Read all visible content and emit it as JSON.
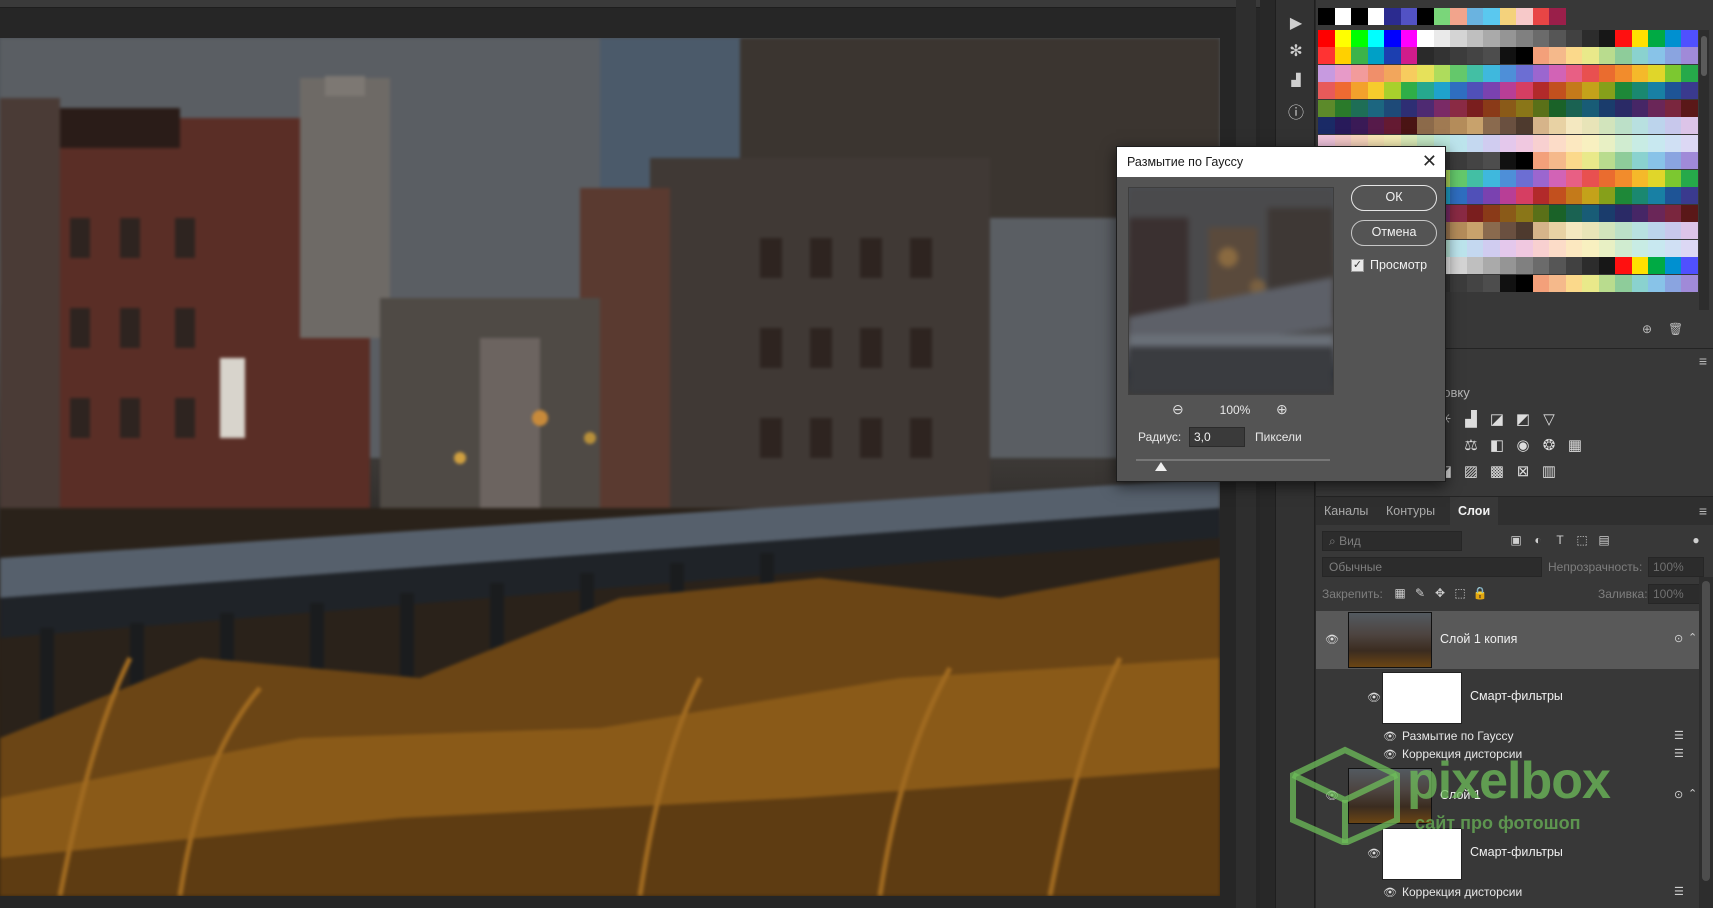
{
  "colors": {
    "accent_watermark": "#6ebe5a",
    "dialog_bg": "#545454",
    "panel_bg": "#383838"
  },
  "dialog": {
    "title": "Размытие по Гауссу",
    "close_icon": "close-icon",
    "ok_label": "ОК",
    "cancel_label": "Отмена",
    "preview_label": "Просмотр",
    "preview_checked": true,
    "zoom": "100%",
    "radius_label": "Радиус:",
    "radius_value": "3,0",
    "radius_unit": "Пиксели",
    "radius_slider_fraction": 0.13
  },
  "adjustments": {
    "title_fragment": "ровку"
  },
  "layers": {
    "tabs": [
      "Каналы",
      "Контуры",
      "Слои"
    ],
    "active_tab": "Слои",
    "filter_placeholder": "Вид",
    "blend_mode": "Обычные",
    "opacity_label": "Непрозрачность:",
    "opacity_value": "100%",
    "lock_label": "Закрепить:",
    "fill_label": "Заливка:",
    "fill_value": "100%",
    "items": [
      {
        "name": "Слой 1 копия",
        "selected": true
      },
      {
        "name": "Смарт-фильтры"
      },
      {
        "name": "Размытие по Гауссу"
      },
      {
        "name": "Коррекция дисторсии"
      },
      {
        "name": "Слой 1",
        "selected": false
      },
      {
        "name": "Смарт-фильтры"
      },
      {
        "name": "Коррекция дисторсии"
      }
    ]
  },
  "watermark": {
    "brand": "pixelbox",
    "tagline": "сайт про фотошоп"
  },
  "swatches": {
    "rows": [
      [
        "#000000",
        "#ffffff",
        "#000000",
        "#ffffff",
        "#2b2b8f",
        "#5252c4",
        "#000000",
        "#7ad67a",
        "#f2a48c",
        "#6ab3e0",
        "#5ac8ef",
        "#f4d27c",
        "#f7c9c9",
        "#e84545",
        "#9a1f4a"
      ],
      [
        "#ff0000",
        "#ffff00",
        "#00ff00",
        "#00ffff",
        "#0000ff",
        "#ff00ff",
        "#ffffff",
        "#eaeaea",
        "#d4d4d4",
        "#bfbfbf",
        "#aaaaaa",
        "#959595",
        "#808080",
        "#6b6b6b",
        "#565656",
        "#414141",
        "#2c2c2c",
        "#171717",
        "#ff1010",
        "#ffe000",
        "#00aa44",
        "#0090d0",
        "#5050ff"
      ],
      [
        "#ff3333",
        "#ffd000",
        "#3cb34a",
        "#00a0c6",
        "#1c3fb0",
        "#d01c8b",
        "#2a2a2a",
        "#333333",
        "#3c3c3c",
        "#444444",
        "#4d4d4d",
        "#111111",
        "#000000",
        "#f3a07a",
        "#f5b98b",
        "#fbd98b",
        "#e9e98a",
        "#b9dc8e",
        "#8ecc9a",
        "#8ad2cf",
        "#88c3e8",
        "#8aa4e0",
        "#a08ad8"
      ],
      [
        "#c79ae0",
        "#e79ac8",
        "#f29b9b",
        "#f08f6a",
        "#f2a65c",
        "#f7cc5e",
        "#e6e15a",
        "#aedc5c",
        "#64c86b",
        "#43bfa4",
        "#3fb8dd",
        "#4e8fd8",
        "#6c6ed3",
        "#9b66cf",
        "#d263b6",
        "#e85f84",
        "#e85050",
        "#ea6c2f",
        "#f28c2c",
        "#f5b92a",
        "#e0d62a",
        "#7cc830",
        "#26a94a"
      ],
      [
        "#e85a5a",
        "#ef6a32",
        "#f3a12c",
        "#f6cc2c",
        "#a8d02c",
        "#2fae47",
        "#26a88e",
        "#1fa2cc",
        "#2f6ec0",
        "#5050b8",
        "#7a42b0",
        "#b83e96",
        "#d63e62",
        "#b22a2a",
        "#c2501e",
        "#c47a1a",
        "#c4a21a",
        "#86a01a",
        "#1e8838",
        "#1a8870",
        "#1880a4",
        "#1e5496",
        "#3a3a8e"
      ],
      [
        "#5c8a2a",
        "#2a7a2a",
        "#1e6e56",
        "#1c6680",
        "#1e4a78",
        "#2e2e74",
        "#4e2a72",
        "#7a2a66",
        "#8a2a44",
        "#7a1e1e",
        "#8a3a18",
        "#8a5a18",
        "#8a7618",
        "#5a7018",
        "#1a6228",
        "#1a6252",
        "#185c76",
        "#1a3c6c",
        "#2a2a66",
        "#462666",
        "#6a2658",
        "#7a263e",
        "#5a1818"
      ],
      [
        "#1a2a66",
        "#281a5a",
        "#3a1a56",
        "#561a4a",
        "#641a32",
        "#4a1414",
        "#8c6a4a",
        "#a07a52",
        "#b48c5a",
        "#c8a26c",
        "#8a6a4e",
        "#6a5040",
        "#4e3a2e",
        "#d6b48a",
        "#e8d2a4",
        "#f4e8c0",
        "#e8e4b8",
        "#d2e4bc",
        "#bce0c8",
        "#b8e0e0",
        "#bcd4ec",
        "#c8c8ec",
        "#dcc4e8"
      ],
      [
        "#f0c4dc",
        "#f4c8c8",
        "#f8d4bc",
        "#f8e4b4",
        "#f4ecb4",
        "#dcecb8",
        "#c4e8c4",
        "#bce8dc",
        "#bce4ec",
        "#c4d8f0",
        "#d0ccf0",
        "#e4c8ec",
        "#f0c8e0",
        "#f8d0d0",
        "#fcdcc8",
        "#fce8c0",
        "#f8f0c0",
        "#e8f0c4",
        "#d0ecd0",
        "#c8ece4",
        "#c8e8f0",
        "#d0e0f4",
        "#dcd8f4"
      ]
    ]
  }
}
